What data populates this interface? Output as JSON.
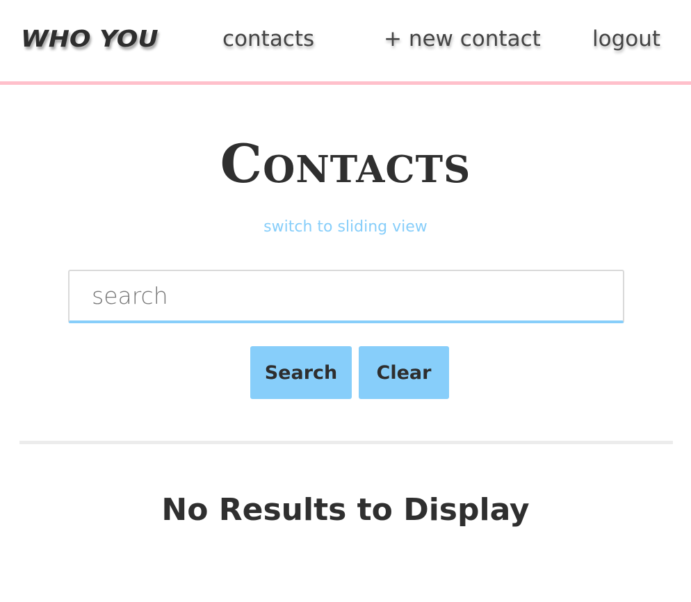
{
  "navbar": {
    "brand": "WHO YOU",
    "links": {
      "contacts": "contacts",
      "new_contact": "+ new contact",
      "logout": "logout"
    },
    "border_color": "#ffc0cb"
  },
  "main": {
    "title": "Contacts",
    "switch_view_link": "switch to sliding view",
    "search": {
      "placeholder": "search",
      "value": ""
    },
    "buttons": {
      "search": "Search",
      "clear": "Clear"
    },
    "empty_message": "No Results to Display"
  },
  "colors": {
    "accent": "#87cefa",
    "nav_border": "#ffc0cb",
    "text": "#333333"
  }
}
